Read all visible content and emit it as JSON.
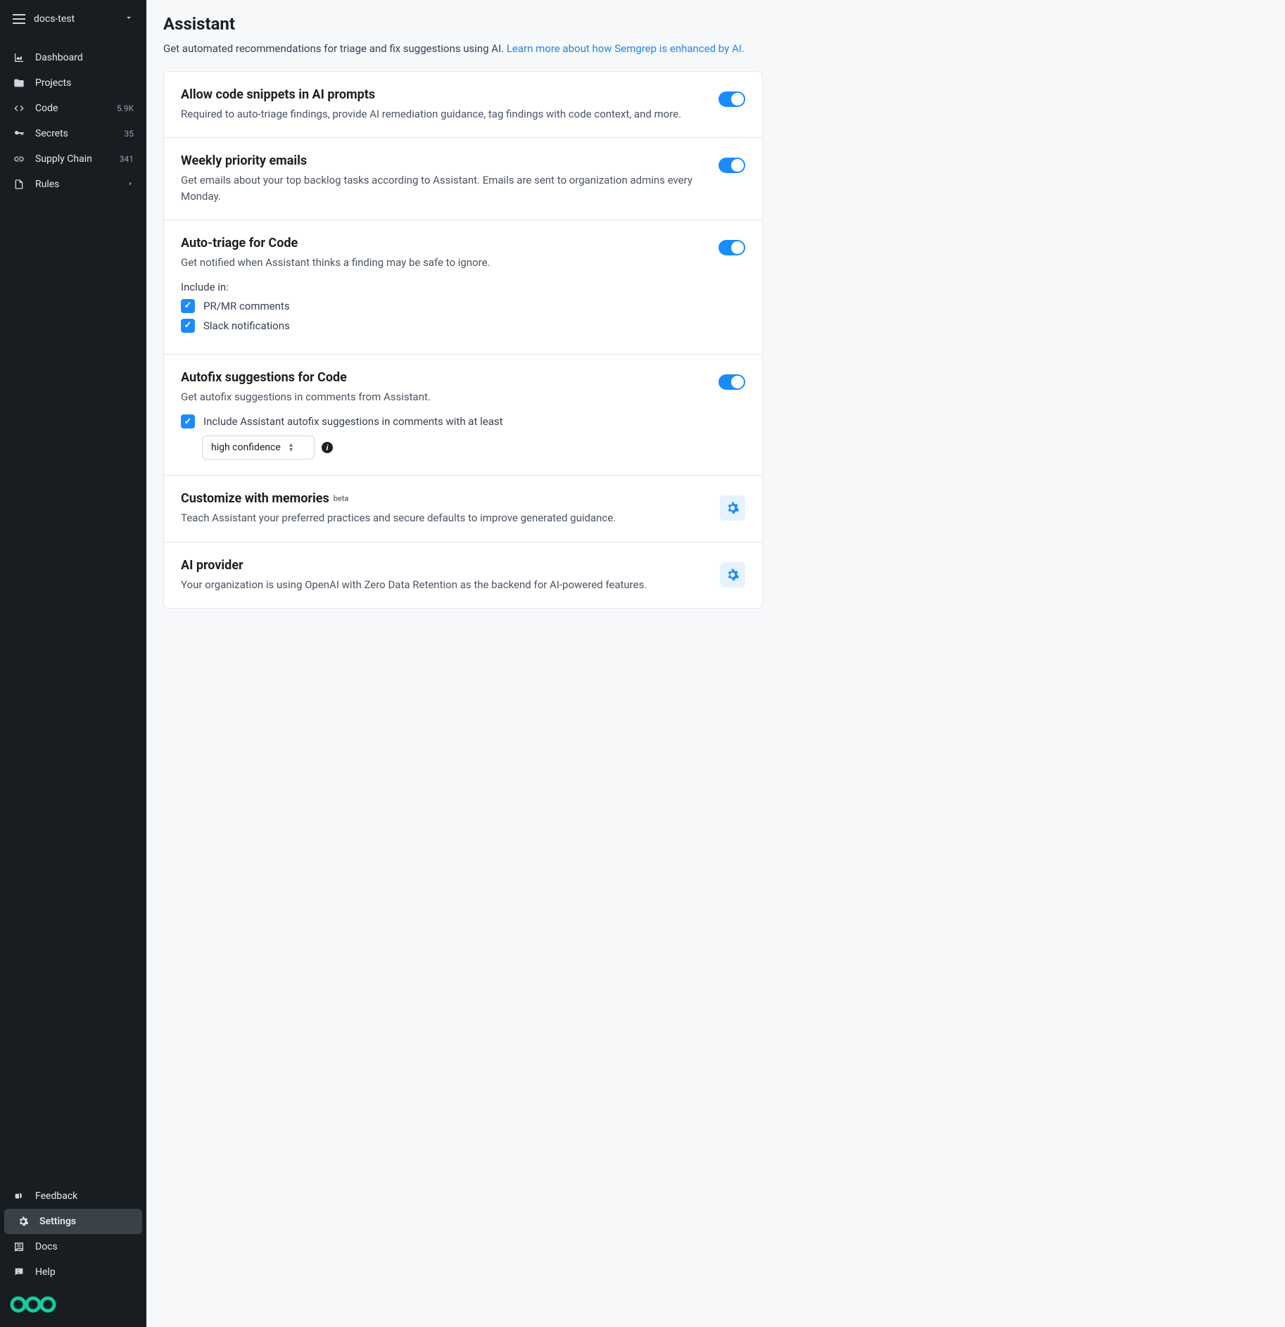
{
  "sidebar": {
    "org_name": "docs-test",
    "items": [
      {
        "label": "Dashboard",
        "badge": ""
      },
      {
        "label": "Projects",
        "badge": ""
      },
      {
        "label": "Code",
        "badge": "5.9K"
      },
      {
        "label": "Secrets",
        "badge": "35"
      },
      {
        "label": "Supply Chain",
        "badge": "341"
      },
      {
        "label": "Rules",
        "badge": ""
      }
    ],
    "bottom_items": [
      {
        "label": "Feedback"
      },
      {
        "label": "Settings"
      },
      {
        "label": "Docs"
      },
      {
        "label": "Help"
      }
    ]
  },
  "page": {
    "title": "Assistant",
    "subtitle_text": "Get automated recommendations for triage and fix suggestions using AI. ",
    "subtitle_link": "Learn more about how Semgrep is enhanced by AI."
  },
  "sections": {
    "snippets": {
      "title": "Allow code snippets in AI prompts",
      "desc": "Required to auto-triage findings, provide AI remediation guidance, tag findings with code context, and more."
    },
    "weekly": {
      "title": "Weekly priority emails",
      "desc": "Get emails about your top backlog tasks according to Assistant. Emails are sent to organization admins every Monday."
    },
    "autotriage": {
      "title": "Auto-triage for Code",
      "desc": "Get notified when Assistant thinks a finding may be safe to ignore.",
      "include_label": "Include in:",
      "checkbox1": "PR/MR comments",
      "checkbox2": "Slack notifications"
    },
    "autofix": {
      "title": "Autofix suggestions for Code",
      "desc": "Get autofix suggestions in comments from Assistant.",
      "checkbox_label": "Include Assistant autofix suggestions in comments with at least",
      "select_value": "high confidence"
    },
    "memories": {
      "title": "Customize with memories",
      "beta": "beta",
      "desc": "Teach Assistant your preferred practices and secure defaults to improve generated guidance."
    },
    "provider": {
      "title": "AI provider",
      "desc": "Your organization is using OpenAI with Zero Data Retention as the backend for AI-powered features."
    }
  }
}
